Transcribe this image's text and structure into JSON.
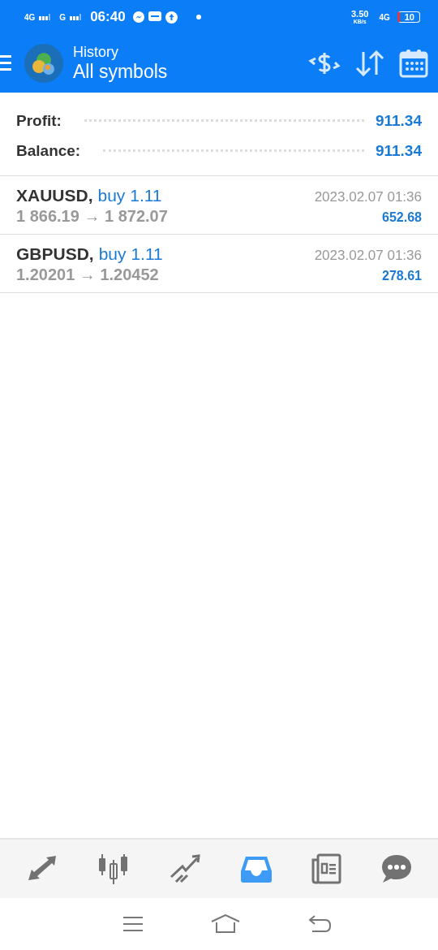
{
  "status_bar": {
    "network_1": "4G",
    "network_2": "G",
    "time": "06:40",
    "speed": "3.50",
    "speed_unit": "KB/s",
    "network_3": "4G",
    "battery": "10"
  },
  "header": {
    "title": "History",
    "subtitle": "All symbols"
  },
  "summary": [
    {
      "label": "Profit:",
      "value": "911.34"
    },
    {
      "label": "Balance:",
      "value": "911.34"
    }
  ],
  "trades": [
    {
      "symbol": "XAUUSD,",
      "side": "buy 1.11",
      "prices": "1 866.19 → 1 872.07",
      "time": "2023.02.07 01:36",
      "profit": "652.68"
    },
    {
      "symbol": "GBPUSD,",
      "side": "buy 1.11",
      "prices": "1.20201 → 1.20452",
      "time": "2023.02.07 01:36",
      "profit": "278.61"
    }
  ],
  "bottom_nav": [
    {
      "selected": false
    },
    {
      "selected": false
    },
    {
      "selected": false
    },
    {
      "selected": true
    },
    {
      "selected": false
    },
    {
      "selected": false
    }
  ]
}
